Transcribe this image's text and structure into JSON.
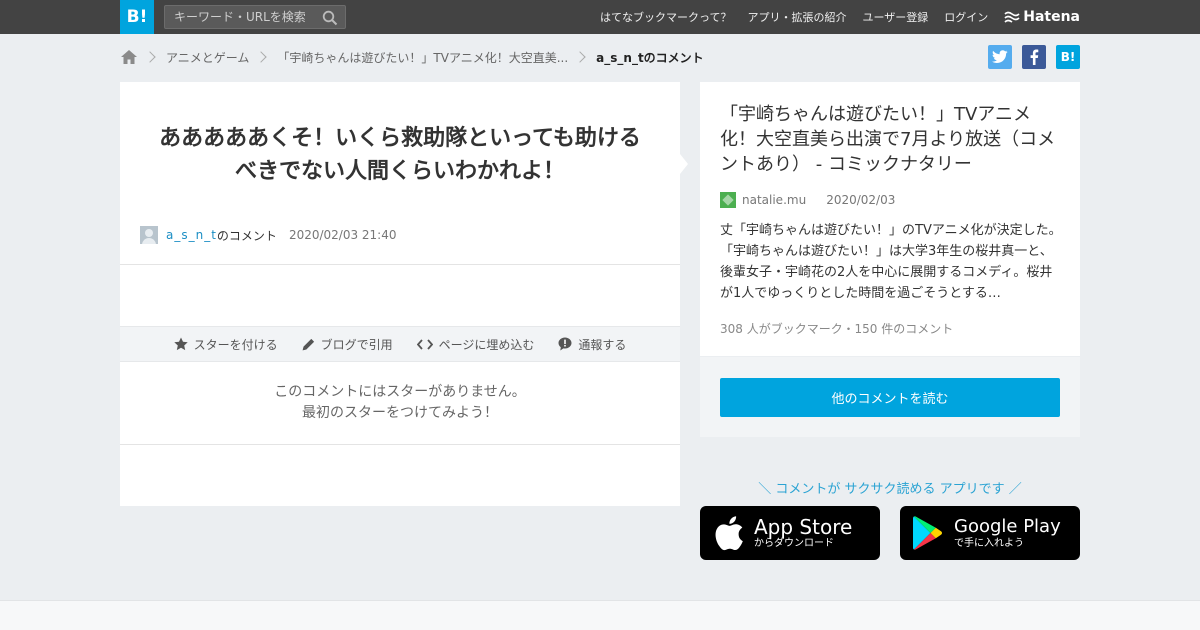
{
  "header": {
    "logo": "B!",
    "search_placeholder": "キーワード・URLを検索",
    "nav": [
      "はてなブックマークって？",
      "アプリ・拡張の紹介",
      "ユーザー登録",
      "ログイン"
    ],
    "hatena": "Hatena"
  },
  "breadcrumb": {
    "items": [
      "アニメとゲーム",
      "「宇崎ちゃんは遊びたい！」TVアニメ化！大空直美...",
      "a_s_n_tのコメント"
    ]
  },
  "share": {
    "twitter": "t",
    "facebook": "f",
    "hatebu": "B!"
  },
  "comment": {
    "text": "あああああくそ！いくら救助隊といっても助けるべきでない人間くらいわかれよ！",
    "user": "a_s_n_t",
    "user_suffix": "のコメント",
    "datetime": "2020/02/03 21:40"
  },
  "actions": [
    "スターを付ける",
    "ブログで引用",
    "ページに埋め込む",
    "通報する"
  ],
  "no_star": {
    "line1": "このコメントにはスターがありません。",
    "line2": "最初のスターをつけてみよう！"
  },
  "entry": {
    "title": "「宇崎ちゃんは遊びたい！」TVアニメ化！大空直美ら出演で7月より放送（コメントあり） - コミックナタリー",
    "site": "natalie.mu",
    "date": "2020/02/03",
    "description": "丈「宇崎ちゃんは遊びたい！」のTVアニメ化が決定した。「宇崎ちゃんは遊びたい！」は大学3年生の桜井真一と、後輩女子・宇崎花の2人を中心に展開するコメディ。桜井が1人でゆっくりとした時間を過ごそうとする…",
    "stats": "308 人がブックマーク・150 件のコメント"
  },
  "more_button": "他のコメントを読む",
  "promo": "＼ コメントが サクサク読める アプリです ／",
  "app_store": {
    "big": "App Store",
    "small": "からダウンロード"
  },
  "google_play": {
    "big": "Google Play",
    "small": "で手に入れよう"
  },
  "colors": {
    "accent": "#00a4de",
    "topbar": "#434343",
    "twitter": "#55acee",
    "facebook": "#3b5998"
  }
}
